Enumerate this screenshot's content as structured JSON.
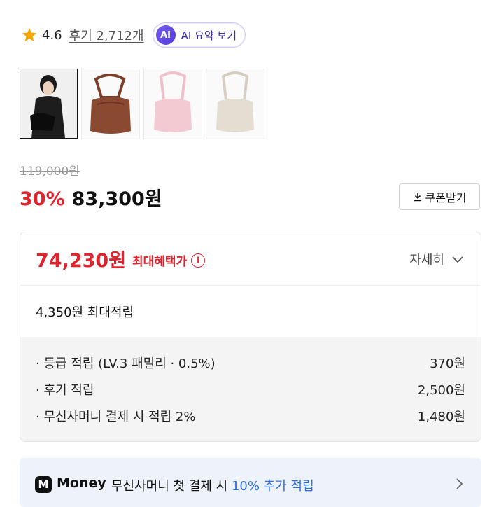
{
  "rating": {
    "score": "4.6",
    "reviews_label": "후기 2,712개",
    "star_color": "#f7a600"
  },
  "ai_summary": {
    "badge": "AI",
    "label": "AI 요약 보기"
  },
  "gallery": [
    {
      "alt": "model-wearing-black-bag",
      "color": "#1b1b1b"
    },
    {
      "alt": "brown-bag",
      "color": "#8a4a32"
    },
    {
      "alt": "pink-bag",
      "color": "#f3c9d2"
    },
    {
      "alt": "beige-bag",
      "color": "#e4ddd2"
    }
  ],
  "price": {
    "original": "119,000원",
    "discount": "30%",
    "sale": "83,300원",
    "coupon_label": "쿠폰받기"
  },
  "benefit": {
    "max_price": "74,230원",
    "max_label": "최대혜택가",
    "info_icon": "i",
    "detail_label": "자세히",
    "points_total": "4,350원 최대적립",
    "points": [
      {
        "label": "· 등급 적립 (LV.3 패밀리 · 0.5%)",
        "value": "370원"
      },
      {
        "label": "· 후기 적립",
        "value": "2,500원"
      },
      {
        "label": "· 무신사머니 결제 시 적립 2%",
        "value": "1,480원"
      }
    ]
  },
  "money_promo": {
    "logo": "M",
    "brand": "Money",
    "text": "무신사머니 첫 결제 시 ",
    "accent": "10% 추가 적립"
  },
  "colors": {
    "sale_red": "#e0242e",
    "accent_blue": "#2b6fe0"
  }
}
